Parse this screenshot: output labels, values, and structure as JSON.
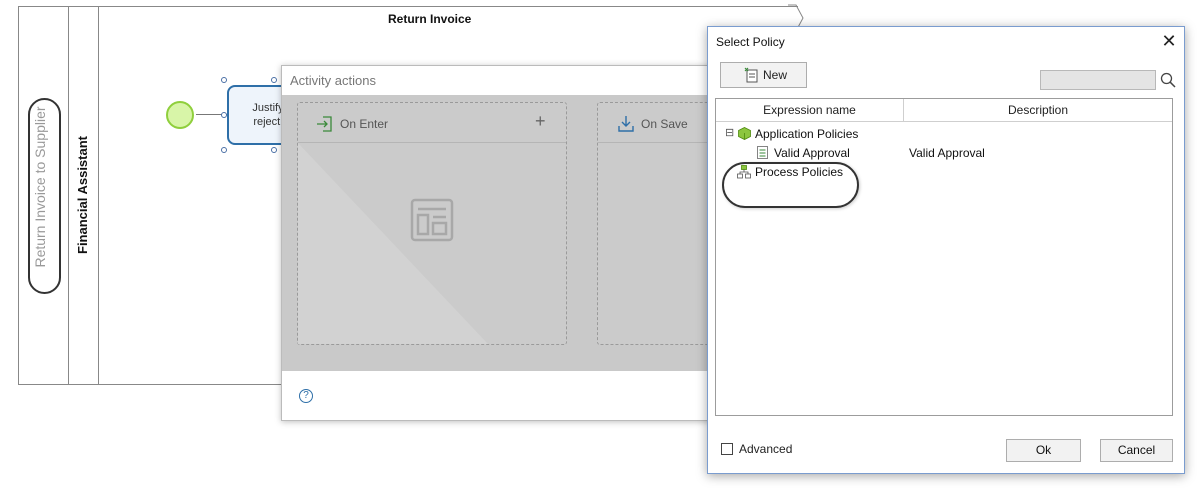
{
  "diagram": {
    "pool_title": "Return Invoice",
    "pool_name": "Return Invoice to Supplier",
    "lane_name": "Financial Assistant",
    "task_label_line1": "Justify",
    "task_label_line2": "rejecti"
  },
  "activity_actions": {
    "title": "Activity actions",
    "on_enter_label": "On Enter",
    "on_save_label": "On Save",
    "add_symbol": "+",
    "help_symbol": "?"
  },
  "select_policy": {
    "title": "Select Policy",
    "close_symbol": "✕",
    "new_button_label": "New",
    "search_value": "",
    "columns": {
      "expression_name": "Expression name",
      "description": "Description"
    },
    "tree": [
      {
        "label": "Application Policies",
        "expander": "⊟",
        "icon": "package-icon"
      },
      {
        "label": "Valid Approval",
        "description": "Valid Approval",
        "icon": "policy-icon"
      },
      {
        "label": "Process Policies",
        "icon": "process-icon"
      }
    ],
    "advanced_label": "Advanced",
    "advanced_checked": false,
    "ok_label": "Ok",
    "cancel_label": "Cancel"
  },
  "colors": {
    "task_border": "#2e6fa8",
    "start_event_fill": "#d8f5a8",
    "start_event_border": "#8fcf3c",
    "dialog_border": "#7a9ccf",
    "overlay_gray": "#c9c9c9"
  }
}
